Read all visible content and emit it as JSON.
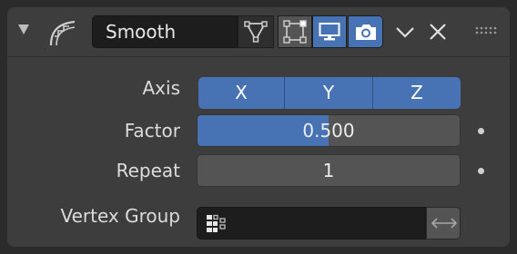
{
  "header": {
    "modifier_name": "Smooth",
    "icons": [
      "collapse-arrow-icon",
      "smooth-modifier-icon",
      "edit-mode-icon",
      "on-cage-icon",
      "realtime-display-icon",
      "render-icon",
      "dropdown-chevron-icon",
      "close-icon",
      "drag-handle-icon"
    ],
    "toggles": {
      "edit_mode": false,
      "on_cage": false,
      "realtime": true,
      "render": true
    }
  },
  "axis": {
    "label": "Axis",
    "options": [
      "X",
      "Y",
      "Z"
    ],
    "selected": [
      "X",
      "Y",
      "Z"
    ]
  },
  "factor": {
    "label": "Factor",
    "value": "0.500",
    "fill": 0.5
  },
  "repeat": {
    "label": "Repeat",
    "value": "1"
  },
  "vertex_group": {
    "label": "Vertex Group",
    "value": ""
  },
  "colors": {
    "accent": "#4772b3",
    "panel": "#3d3d3d",
    "field": "#1d1d1d",
    "background": "#2b2b2b"
  }
}
